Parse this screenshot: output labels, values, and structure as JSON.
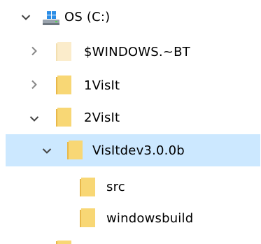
{
  "tree": {
    "drive": {
      "label": "OS (C:)",
      "icon": "drive-windows-icon",
      "expanded": true
    },
    "items": [
      {
        "label": "$WINDOWS.~BT",
        "icon": "folder-icon",
        "hidden": true,
        "expanded": false,
        "level": 1
      },
      {
        "label": "1VisIt",
        "icon": "folder-icon",
        "hidden": false,
        "expanded": false,
        "level": 1
      },
      {
        "label": "2VisIt",
        "icon": "folder-icon",
        "hidden": false,
        "expanded": true,
        "level": 1
      },
      {
        "label": "VisItdev3.0.0b",
        "icon": "folder-icon",
        "hidden": false,
        "expanded": true,
        "selected": true,
        "level": 2
      },
      {
        "label": "src",
        "icon": "folder-icon",
        "hidden": false,
        "level": 3
      },
      {
        "label": "windowsbuild",
        "icon": "folder-icon",
        "hidden": false,
        "level": 3
      }
    ]
  },
  "colors": {
    "selection": "#cce8ff",
    "folder": "#f8d775",
    "folder_dark": "#e8b84a",
    "folder_hidden": "#fbeccb",
    "chevron": "#555555",
    "drive_blue": "#2b8de6"
  }
}
